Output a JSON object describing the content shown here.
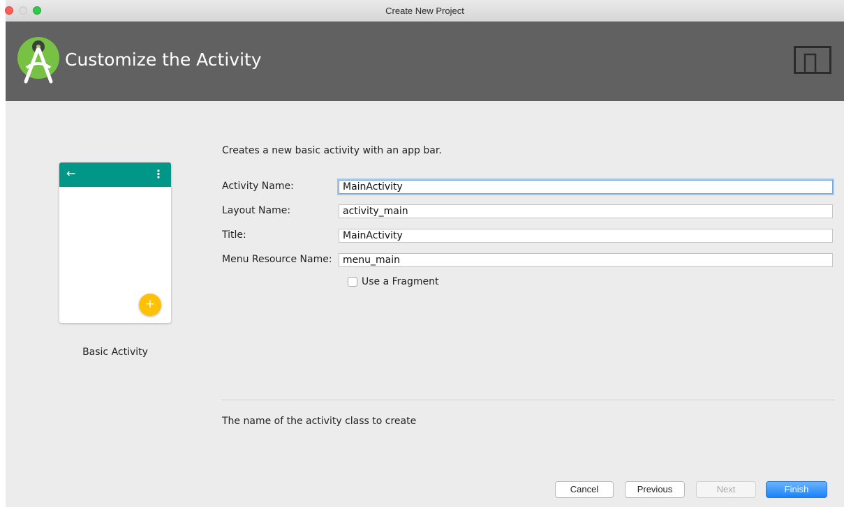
{
  "window": {
    "title": "Create New Project"
  },
  "header": {
    "title": "Customize the Activity"
  },
  "preview": {
    "label": "Basic Activity",
    "back_glyph": "←",
    "more_glyph": "⋮",
    "fab_glyph": "+"
  },
  "form": {
    "description": "Creates a new basic activity with an app bar.",
    "fields": [
      {
        "label": "Activity Name:",
        "value": "MainActivity"
      },
      {
        "label": "Layout Name:",
        "value": "activity_main"
      },
      {
        "label": "Title:",
        "value": "MainActivity"
      },
      {
        "label": "Menu Resource Name:",
        "value": "menu_main"
      }
    ],
    "checkbox": {
      "label": "Use a Fragment",
      "checked": false
    },
    "help_text": "The name of the activity class to create"
  },
  "buttons": {
    "cancel": "Cancel",
    "previous": "Previous",
    "next": "Next",
    "finish": "Finish"
  },
  "colors": {
    "header_bg": "#616161",
    "appbar": "#009688",
    "fab": "#ffc107",
    "finish": "#1a82fb"
  },
  "icons": [
    "android-studio-logo",
    "device-icon",
    "back-arrow-icon",
    "more-vert-icon",
    "add-icon"
  ]
}
